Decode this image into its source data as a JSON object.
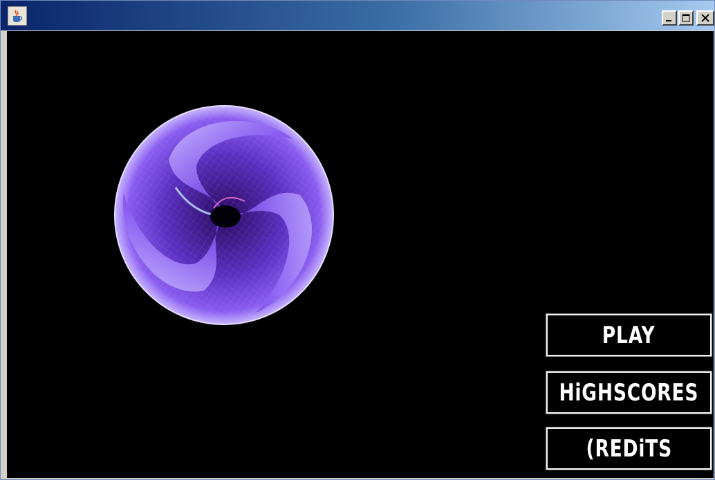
{
  "window": {
    "icon": "java-cup-icon",
    "controls": [
      "minimize-icon",
      "maximize-icon",
      "close-icon"
    ]
  },
  "menu": {
    "play_label": "PLAY",
    "highscores_label": "HiGHSCORES",
    "credits_label": "(REDiTS"
  },
  "colors": {
    "background": "#000000",
    "logo_primary": "#7a4fe0",
    "logo_highlight": "#d8d0ff",
    "button_border": "#f2f2f2",
    "button_text": "#ffffff"
  }
}
